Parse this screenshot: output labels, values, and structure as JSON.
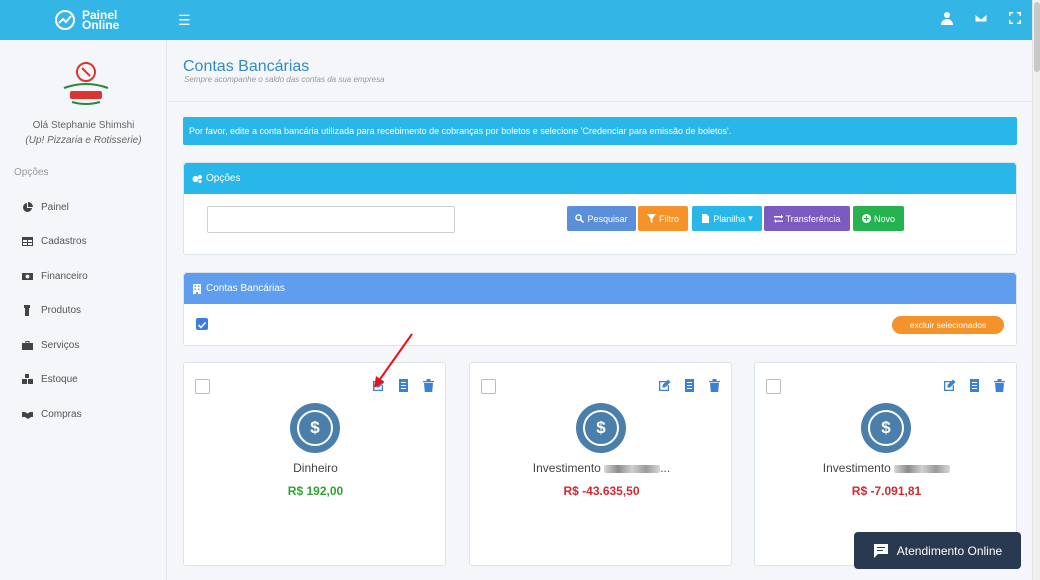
{
  "app": {
    "logo_line1": "Painel",
    "logo_line2": "Online"
  },
  "sidebar": {
    "hello": "Olá Stephanie Shimshi",
    "company": "(Up! Pizzaria e Rotisserie)",
    "options_label": "Opções",
    "items": [
      {
        "label": "Painel",
        "icon": "pie-chart-icon"
      },
      {
        "label": "Cadastros",
        "icon": "table-icon"
      },
      {
        "label": "Financeiro",
        "icon": "money-icon"
      },
      {
        "label": "Produtos",
        "icon": "product-icon"
      },
      {
        "label": "Serviços",
        "icon": "briefcase-icon"
      },
      {
        "label": "Estoque",
        "icon": "boxes-icon"
      },
      {
        "label": "Compras",
        "icon": "handshake-icon"
      }
    ]
  },
  "header": {
    "title": "Contas Bancárias",
    "subtitle": "Sempre acompanhe o saldo das contas da sua empresa"
  },
  "alert": {
    "text": "Por favor, edite a conta bancária utilizada para recebimento de cobranças por boletos e selecione 'Credenciar para emissão de boletos'."
  },
  "options_panel": {
    "title": "Opções",
    "search_value": "",
    "buttons": {
      "pesquisar": "Pesquisar",
      "filtro": "Filtro",
      "planilha": "Planilha",
      "transferencia": "Transferência",
      "novo": "Novo"
    }
  },
  "accounts_panel": {
    "title": "Contas Bancárias",
    "delete_selected": "excluir selecionados"
  },
  "cards": [
    {
      "name": "Dinheiro",
      "balance": "R$ 192,00",
      "balance_color": "#2ea52e"
    },
    {
      "name": "Investimento",
      "suffix": "...",
      "balance": "R$ -43.635,50",
      "balance_color": "#d9262c"
    },
    {
      "name": "Investimento",
      "suffix": "",
      "balance": "R$ -7.091,81",
      "balance_color": "#d9262c"
    }
  ],
  "chat": {
    "label": "Atendimento Online"
  },
  "colors": {
    "topbar": "#33b5e5",
    "info": "#29b6e8",
    "primary": "#5b8fd9",
    "warning": "#f5922a",
    "purple": "#7b5bbf",
    "success": "#25b34f"
  }
}
